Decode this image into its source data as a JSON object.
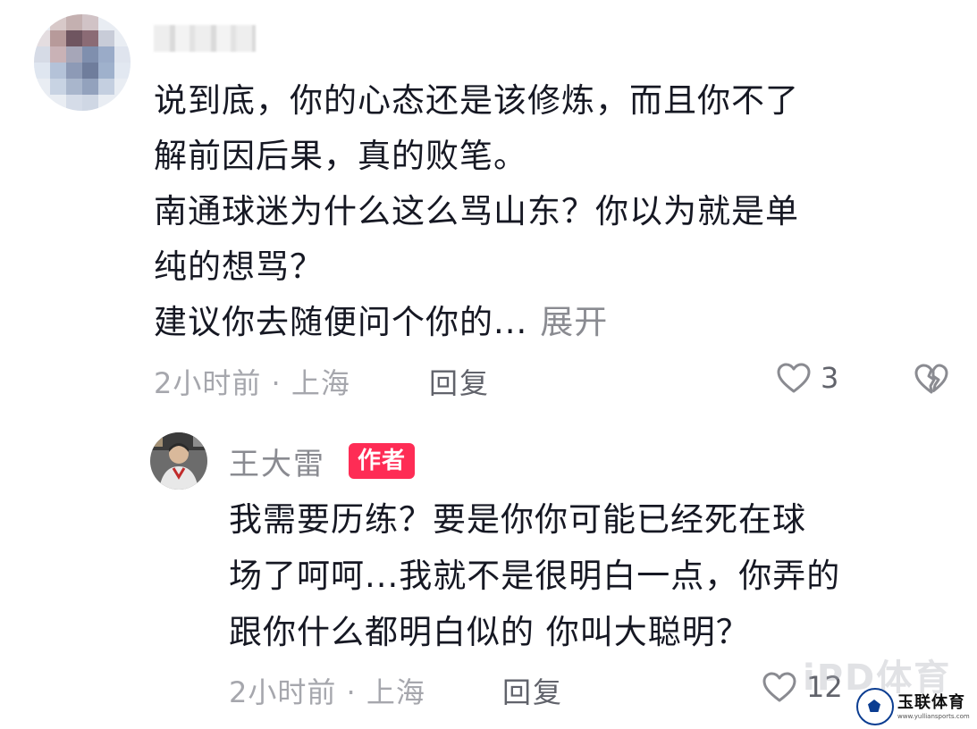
{
  "comment": {
    "username": "",
    "lines": [
      "说到底，你的心态还是该修炼，而且你不了",
      "解前因后果，真的败笔。",
      "南通球迷为什么这么骂山东？你以为就是单",
      "纯的想骂？",
      "建议你去随便问个你的..."
    ],
    "expand_label": "展开",
    "meta": "2小时前 · 上海",
    "reply_label": "回复",
    "like_count": "3"
  },
  "reply": {
    "author_name": "王大雷",
    "author_badge": "作者",
    "lines": [
      "我需要历练？要是你你可能已经死在球",
      "场了呵呵...我就不是很明白一点，你弄的",
      "跟你什么都明白似的 你叫大聪明？"
    ],
    "meta": "2小时前 · 上海",
    "reply_label": "回复",
    "like_count": "12"
  },
  "watermarks": {
    "ipd": "iPD体育",
    "logo_text": "玉联体育",
    "logo_sub": "www.yulliansports.com"
  },
  "colors": {
    "text_primary": "#161823",
    "text_secondary": "#a6a7ad",
    "badge_bg": "#fe2c55"
  }
}
